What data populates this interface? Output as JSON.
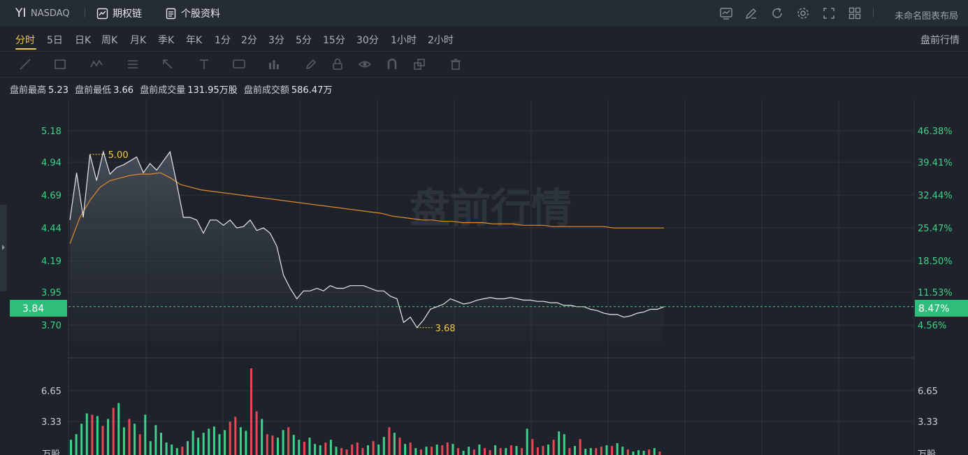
{
  "header": {
    "ticker": "YI",
    "exchange": "NASDAQ",
    "buttons": [
      {
        "label": "期权链",
        "icon": "options-chain-icon"
      },
      {
        "label": "个股资料",
        "icon": "stock-profile-icon"
      }
    ],
    "tools": [
      "chart-type-icon",
      "draw-edit-icon",
      "refresh-icon",
      "settings-gear-icon",
      "fullscreen-icon",
      "grid-layout-icon"
    ],
    "layout_name": "未命名图表布局"
  },
  "periods": {
    "tabs": [
      "分时",
      "5日",
      "日K",
      "周K",
      "月K",
      "季K",
      "年K",
      "1分",
      "2分",
      "3分",
      "5分",
      "15分",
      "30分",
      "1小时",
      "2小时"
    ],
    "active": "分时",
    "session_label": "盘前行情"
  },
  "draw_tools": [
    "line-tool-icon",
    "rect-tool-icon",
    "wave-tool-icon",
    "fib-tool-icon",
    "arrow-tool-icon",
    "text-tool-icon",
    "note-tool-icon",
    "measure-tool-icon",
    "pencil-icon",
    "lock-icon",
    "eye-icon",
    "magnet-icon",
    "layers-icon",
    "trash-icon"
  ],
  "stats": {
    "high_label": "盘前最高",
    "high": "5.23",
    "low_label": "盘前最低",
    "low": "3.66",
    "vol_label": "盘前成交量",
    "vol": "131.95万股",
    "amt_label": "盘前成交额",
    "amt": "586.47万"
  },
  "colors": {
    "up": "#3fd18a",
    "down": "#e84855",
    "avg_line": "#e08a2c",
    "annotation": "#f2c94c",
    "price_line": "#e6e8eb",
    "background": "#1e232b"
  },
  "chart_data": {
    "type": "line",
    "watermark": "盘前行情",
    "price_axis": {
      "ticks": [
        "5.18",
        "4.94",
        "4.69",
        "4.44",
        "4.19",
        "3.95",
        "3.70"
      ],
      "range": [
        3.45,
        5.42
      ]
    },
    "percent_axis": {
      "ticks": [
        "46.38%",
        "39.41%",
        "32.44%",
        "25.47%",
        "18.50%",
        "11.53%",
        "4.56%"
      ]
    },
    "current_price": "3.84",
    "current_change": "8.47%",
    "annotations": [
      {
        "label": "5.00",
        "value": 5.0
      },
      {
        "label": "3.68",
        "value": 3.68
      }
    ],
    "volume_axis": {
      "ticks": [
        "6.65",
        "3.33"
      ],
      "unit": "万股",
      "max": 13.0
    },
    "series": [
      {
        "values": [
          4.5,
          4.86,
          4.52,
          5.0,
          4.8,
          5.02,
          4.85,
          4.9,
          4.92,
          4.95,
          4.98,
          4.86,
          4.93,
          4.88,
          4.95,
          5.02,
          4.78,
          4.52,
          4.52,
          4.5,
          4.4,
          4.5,
          4.5,
          4.46,
          4.5,
          4.44,
          4.45,
          4.5,
          4.42,
          4.44,
          4.4,
          4.3,
          4.08,
          3.98,
          3.9,
          3.96,
          3.96,
          3.98,
          3.96,
          4.0,
          3.98,
          3.98,
          4.0,
          4.0,
          4.0,
          3.98,
          3.96,
          3.96,
          3.92,
          3.9,
          3.72,
          3.76,
          3.68,
          3.74,
          3.82,
          3.84,
          3.86,
          3.9,
          3.88,
          3.86,
          3.87,
          3.89,
          3.9,
          3.91,
          3.9,
          3.9,
          3.91,
          3.9,
          3.89,
          3.89,
          3.88,
          3.88,
          3.87,
          3.87,
          3.85,
          3.85,
          3.84,
          3.84,
          3.82,
          3.81,
          3.79,
          3.78,
          3.78,
          3.76,
          3.77,
          3.79,
          3.8,
          3.82,
          3.82,
          3.84
        ]
      },
      {
        "values": [
          4.32,
          4.52,
          4.65,
          4.75,
          4.8,
          4.82,
          4.84,
          4.85,
          4.85,
          4.86,
          4.82,
          4.77,
          4.75,
          4.73,
          4.72,
          4.71,
          4.7,
          4.69,
          4.68,
          4.67,
          4.66,
          4.65,
          4.64,
          4.63,
          4.62,
          4.61,
          4.6,
          4.59,
          4.58,
          4.57,
          4.56,
          4.55,
          4.53,
          4.52,
          4.51,
          4.5,
          4.5,
          4.49,
          4.49,
          4.48,
          4.48,
          4.48,
          4.47,
          4.47,
          4.47,
          4.46,
          4.46,
          4.46,
          4.45,
          4.45,
          4.45,
          4.45,
          4.45,
          4.45,
          4.44,
          4.44,
          4.44,
          4.44,
          4.44,
          4.44
        ]
      }
    ],
    "volume": {
      "values": [
        2.2,
        3.0,
        4.5,
        6.0,
        5.8,
        5.6,
        4.2,
        5.2,
        6.8,
        7.5,
        4.0,
        5.2,
        4.5,
        3.0,
        5.8,
        2.0,
        4.3,
        3.2,
        1.8,
        1.5,
        1.0,
        1.2,
        2.0,
        3.5,
        2.5,
        3.2,
        3.8,
        4.1,
        3.0,
        3.6,
        4.8,
        5.5,
        4.0,
        3.5,
        12.5,
        6.3,
        5.2,
        3.0,
        2.8,
        2.5,
        3.6,
        4.0,
        2.9,
        2.2,
        1.9,
        2.5,
        1.6,
        1.4,
        1.8,
        2.2,
        1.2,
        1.0,
        0.8,
        1.5,
        1.8,
        1.0,
        1.4,
        2.0,
        1.5,
        2.6,
        4.0,
        3.2,
        2.5,
        1.6,
        1.8,
        1.0,
        0.8,
        1.2,
        1.2,
        1.5,
        1.4,
        1.8,
        1.6,
        1.0,
        0.6,
        1.2,
        0.8,
        1.5,
        1.0,
        0.7,
        1.4,
        1.0,
        1.0,
        1.4,
        1.3,
        1.0,
        3.8,
        2.3,
        1.1,
        1.3,
        1.5,
        2.2,
        3.4,
        3.0,
        1.0,
        1.3,
        2.3,
        0.9,
        1.0,
        1.0,
        1.2,
        1.4,
        1.3,
        1.7,
        1.2,
        0.8,
        0.5,
        0.7,
        0.6,
        0.8,
        1.0,
        0.5
      ],
      "up": [
        1,
        1,
        1,
        1,
        0,
        1,
        0,
        1,
        0,
        1,
        1,
        0,
        1,
        0,
        1,
        1,
        1,
        1,
        1,
        1,
        1,
        0,
        1,
        1,
        1,
        1,
        1,
        1,
        1,
        1,
        0,
        0,
        1,
        1,
        0,
        0,
        1,
        0,
        0,
        1,
        1,
        0,
        1,
        1,
        0,
        1,
        1,
        1,
        0,
        1,
        1,
        0,
        0,
        0,
        0,
        0,
        1,
        0,
        1,
        1,
        0,
        1,
        0,
        1,
        0,
        1,
        0,
        1,
        0,
        1,
        0,
        0,
        1,
        0,
        1,
        1,
        0,
        1,
        0,
        0,
        1,
        0,
        1,
        0,
        1,
        0,
        1,
        0,
        0,
        0,
        1,
        0,
        1,
        1,
        0,
        1,
        0,
        1,
        1,
        0,
        0,
        1,
        0,
        1,
        1,
        0,
        1,
        1,
        1,
        0,
        1,
        0
      ]
    }
  }
}
